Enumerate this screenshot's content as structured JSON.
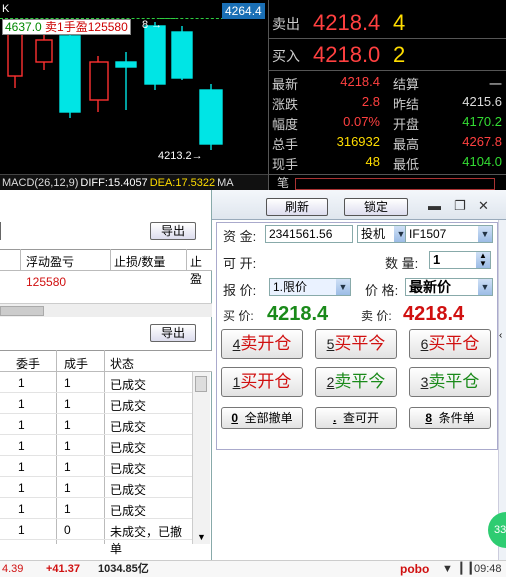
{
  "chart": {
    "period_label": "K",
    "position_label": "4637.0",
    "position_side": "卖1手",
    "position_pnl": "盈125580",
    "position_arrow": "8 →",
    "last_price_tag": "4264.4",
    "low_label": "4213.2→",
    "macd_title": "MACD(26,12,9)",
    "diff": "DIFF:15.4057",
    "dea": "DEA:17.5322",
    "macd_cut": "MA"
  },
  "quote": {
    "ask_label": "卖出",
    "ask_price": "4218.4",
    "ask_qty": "4",
    "bid_label": "买入",
    "bid_price": "4218.0",
    "bid_qty": "2",
    "rows": [
      {
        "l": "最新",
        "lv": "4218.4",
        "r": "结算",
        "rv": "一"
      },
      {
        "l": "涨跌",
        "lv": "2.8",
        "r": "昨结",
        "rv": "4215.6"
      },
      {
        "l": "幅度",
        "lv": "0.07%",
        "r": "开盘",
        "rv": "4170.2"
      },
      {
        "l": "总手",
        "lv": "316932",
        "r": "最高",
        "rv": "4267.8"
      },
      {
        "l": "现手",
        "lv": "48",
        "r": "最低",
        "rv": "4104.0"
      }
    ],
    "strip_label": "笔"
  },
  "positions": {
    "export_label": "导出",
    "headers": [
      "浮动盈亏",
      "止损/数量",
      "止盈"
    ],
    "pnl_value": "125580"
  },
  "orders": {
    "export_label": "导出",
    "headers": [
      "委手",
      "成手",
      "状态"
    ],
    "rows": [
      {
        "q": "1",
        "f": "1",
        "s": "已成交"
      },
      {
        "q": "1",
        "f": "1",
        "s": "已成交"
      },
      {
        "q": "1",
        "f": "1",
        "s": "已成交"
      },
      {
        "q": "1",
        "f": "1",
        "s": "已成交"
      },
      {
        "q": "1",
        "f": "1",
        "s": "已成交"
      },
      {
        "q": "1",
        "f": "1",
        "s": "已成交"
      },
      {
        "q": "1",
        "f": "1",
        "s": "已成交"
      },
      {
        "q": "1",
        "f": "0",
        "s": "未成交，已撤单"
      }
    ]
  },
  "order_panel": {
    "refresh_label": "刷新",
    "lock_label": "锁定",
    "fund_label": "资 金:",
    "fund_value": "2341561.56",
    "hedge_value": "投机",
    "contract_value": "IF1507",
    "open_label": "可 开:",
    "qty_label": "数 量:",
    "qty_value": "1",
    "price_type_label": "报 价:",
    "price_type_value": "1.限价",
    "price_label": "价 格:",
    "price_value": "最新价",
    "buy_price_label": "买 价:",
    "buy_price": "4218.4",
    "sell_price_label": "卖 价:",
    "sell_price": "4218.4",
    "actions": [
      {
        "n": "4",
        "t": "卖开仓"
      },
      {
        "n": "5",
        "t": "买平今"
      },
      {
        "n": "6",
        "t": "买平仓"
      },
      {
        "n": "1",
        "t": "买开仓"
      },
      {
        "n": "2",
        "t": "卖平今"
      },
      {
        "n": "3",
        "t": "卖平仓"
      }
    ],
    "cancel_all": {
      "n": "0",
      "t": "全部撤单"
    },
    "query_open": {
      "n": ".",
      "t": "查可开"
    },
    "conditional": {
      "n": "8",
      "t": "条件单"
    }
  },
  "status": {
    "v1": "4.39",
    "v2": "+41.37",
    "v3": "1034.85亿",
    "brand": "pobo",
    "time": "09:48"
  },
  "badge": "33"
}
